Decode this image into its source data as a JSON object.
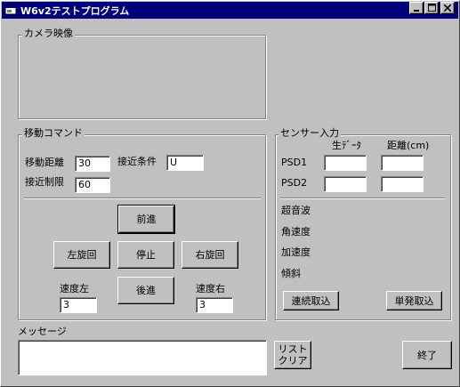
{
  "window": {
    "title": "W6v2テストプログラム"
  },
  "camera": {
    "label": "カメラ映像"
  },
  "move": {
    "label": "移動コマンド",
    "distance_label": "移動距離",
    "distance_value": "30",
    "condition_label": "接近条件",
    "condition_value": "U",
    "limit_label": "接近制限",
    "limit_value": "60",
    "forward": "前進",
    "turn_left": "左旋回",
    "stop": "停止",
    "turn_right": "右旋回",
    "backward": "後進",
    "speed_left_label": "速度左",
    "speed_left_value": "3",
    "speed_right_label": "速度右",
    "speed_right_value": "3"
  },
  "sensor": {
    "label": "センサー入力",
    "col_raw": "生ﾃﾞｰﾀ",
    "col_dist": "距離(cm)",
    "psd1": "PSD1",
    "psd2": "PSD2",
    "psd1_raw": "",
    "psd1_dist": "",
    "psd2_raw": "",
    "psd2_dist": "",
    "ultrasonic": "超音波",
    "angular_velocity": "角速度",
    "acceleration": "加速度",
    "tilt": "傾斜",
    "continuous": "連続取込",
    "single": "単発取込"
  },
  "message": {
    "label": "メッセージ",
    "value": "",
    "clear_line1": "リスト",
    "clear_line2": "クリア"
  },
  "exit": "終了"
}
